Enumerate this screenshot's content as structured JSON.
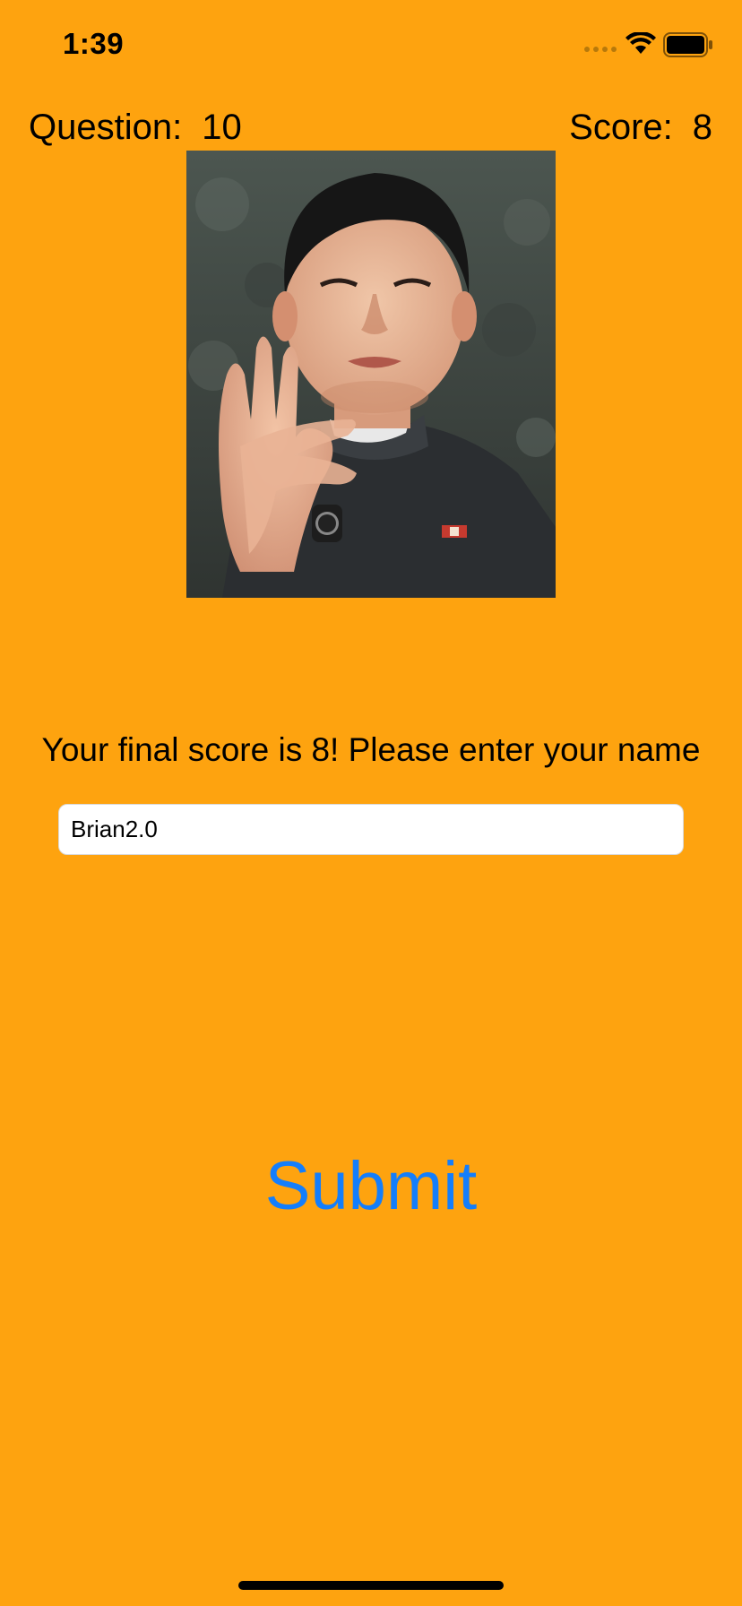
{
  "status_bar": {
    "time": "1:39",
    "icons": [
      "signal-dots-icon",
      "wifi-icon",
      "battery-icon"
    ]
  },
  "header": {
    "question_label": "Question:",
    "question_number": "10",
    "score_label": "Score:",
    "score_value": "8"
  },
  "image": {
    "description_icon": "portrait-photo"
  },
  "main": {
    "final_message": "Your final score is 8! Please enter your name",
    "name_value": "Brian2.0",
    "submit_label": "Submit"
  },
  "colors": {
    "background": "#FEA30F",
    "accent": "#147EFB"
  }
}
